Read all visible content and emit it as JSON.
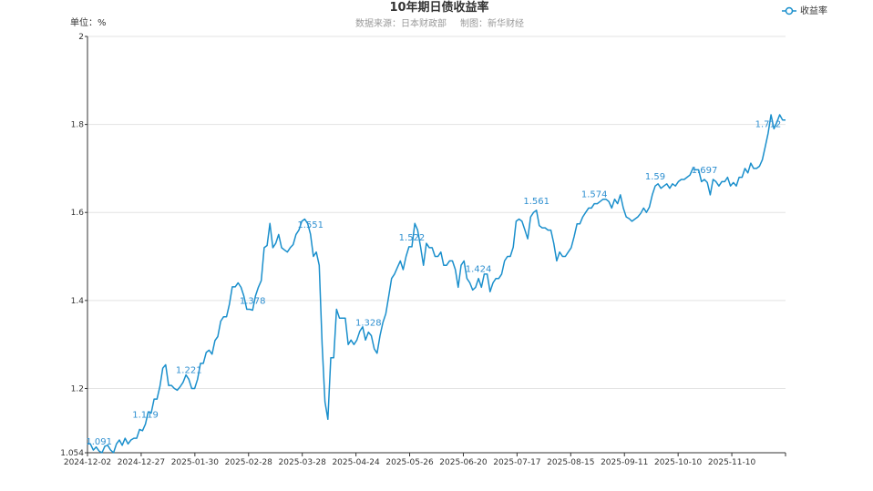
{
  "chart_data": {
    "type": "line",
    "title": "10年期日债收益率",
    "subtitle_source": "数据来源：日本财政部",
    "subtitle_author": "制图：新华财经",
    "unit_label": "单位：%",
    "legend": [
      "收益率"
    ],
    "series_color": "#1a8fcc",
    "grid": true,
    "ylim": [
      1.054,
      2.0
    ],
    "y_ticks": [
      "1.054",
      "1.2",
      "1.4",
      "1.6",
      "1.8",
      "2"
    ],
    "x_labels": [
      "2024-12-02",
      "2024-12-27",
      "2025-01-30",
      "2025-02-28",
      "2025-03-28",
      "2025-04-24",
      "2025-05-26",
      "2025-06-20",
      "2025-07-17",
      "2025-08-15",
      "2025-09-11",
      "2025-10-10",
      "2025-11-10"
    ],
    "series": [
      {
        "name": "收益率",
        "values": [
          1.075,
          1.074,
          1.06,
          1.067,
          1.058,
          1.054,
          1.069,
          1.071,
          1.06,
          1.054,
          1.074,
          1.083,
          1.071,
          1.087,
          1.074,
          1.083,
          1.087,
          1.087,
          1.107,
          1.104,
          1.119,
          1.147,
          1.144,
          1.176,
          1.176,
          1.205,
          1.246,
          1.254,
          1.207,
          1.207,
          1.2,
          1.196,
          1.204,
          1.214,
          1.231,
          1.221,
          1.2,
          1.2,
          1.221,
          1.257,
          1.257,
          1.282,
          1.287,
          1.278,
          1.309,
          1.318,
          1.353,
          1.363,
          1.363,
          1.391,
          1.431,
          1.431,
          1.44,
          1.43,
          1.41,
          1.38,
          1.38,
          1.378,
          1.41,
          1.43,
          1.445,
          1.52,
          1.525,
          1.575,
          1.52,
          1.53,
          1.55,
          1.52,
          1.515,
          1.51,
          1.52,
          1.527,
          1.55,
          1.56,
          1.58,
          1.585,
          1.575,
          1.551,
          1.5,
          1.51,
          1.48,
          1.3,
          1.17,
          1.13,
          1.27,
          1.27,
          1.38,
          1.36,
          1.36,
          1.36,
          1.3,
          1.31,
          1.3,
          1.31,
          1.33,
          1.34,
          1.31,
          1.328,
          1.32,
          1.29,
          1.28,
          1.32,
          1.35,
          1.37,
          1.41,
          1.45,
          1.46,
          1.475,
          1.49,
          1.47,
          1.5,
          1.522,
          1.522,
          1.575,
          1.56,
          1.522,
          1.48,
          1.53,
          1.52,
          1.52,
          1.5,
          1.5,
          1.51,
          1.48,
          1.48,
          1.49,
          1.49,
          1.47,
          1.43,
          1.48,
          1.49,
          1.45,
          1.44,
          1.424,
          1.43,
          1.45,
          1.43,
          1.46,
          1.46,
          1.42,
          1.44,
          1.45,
          1.45,
          1.46,
          1.49,
          1.5,
          1.5,
          1.521,
          1.58,
          1.585,
          1.58,
          1.561,
          1.54,
          1.59,
          1.6,
          1.605,
          1.57,
          1.565,
          1.565,
          1.56,
          1.56,
          1.53,
          1.49,
          1.51,
          1.5,
          1.5,
          1.51,
          1.52,
          1.545,
          1.574,
          1.574,
          1.59,
          1.6,
          1.61,
          1.61,
          1.62,
          1.62,
          1.625,
          1.63,
          1.63,
          1.625,
          1.61,
          1.63,
          1.62,
          1.64,
          1.61,
          1.59,
          1.586,
          1.58,
          1.585,
          1.59,
          1.598,
          1.61,
          1.6,
          1.612,
          1.64,
          1.66,
          1.665,
          1.655,
          1.66,
          1.665,
          1.655,
          1.665,
          1.66,
          1.67,
          1.675,
          1.675,
          1.68,
          1.685,
          1.7,
          1.697,
          1.697,
          1.67,
          1.675,
          1.668,
          1.64,
          1.675,
          1.67,
          1.66,
          1.67,
          1.67,
          1.68,
          1.66,
          1.668,
          1.66,
          1.68,
          1.68,
          1.7,
          1.69,
          1.712,
          1.7,
          1.7,
          1.705,
          1.72,
          1.75,
          1.78,
          1.822,
          1.79,
          1.805,
          1.822,
          1.81,
          1.81
        ]
      }
    ],
    "data_labels": [
      {
        "i": 4,
        "text": "1.091"
      },
      {
        "i": 20,
        "text": "1.119"
      },
      {
        "i": 35,
        "text": "1.221"
      },
      {
        "i": 57,
        "text": "1.378"
      },
      {
        "i": 77,
        "text": "1.551"
      },
      {
        "i": 97,
        "text": "1.328"
      },
      {
        "i": 112,
        "text": "1.522"
      },
      {
        "i": 135,
        "text": "1.424"
      },
      {
        "i": 155,
        "text": "1.561"
      },
      {
        "i": 175,
        "text": "1.574"
      },
      {
        "i": 196,
        "text": "1.59"
      },
      {
        "i": 213,
        "text": "1.697"
      },
      {
        "i": 235,
        "text": "1.712"
      }
    ]
  }
}
